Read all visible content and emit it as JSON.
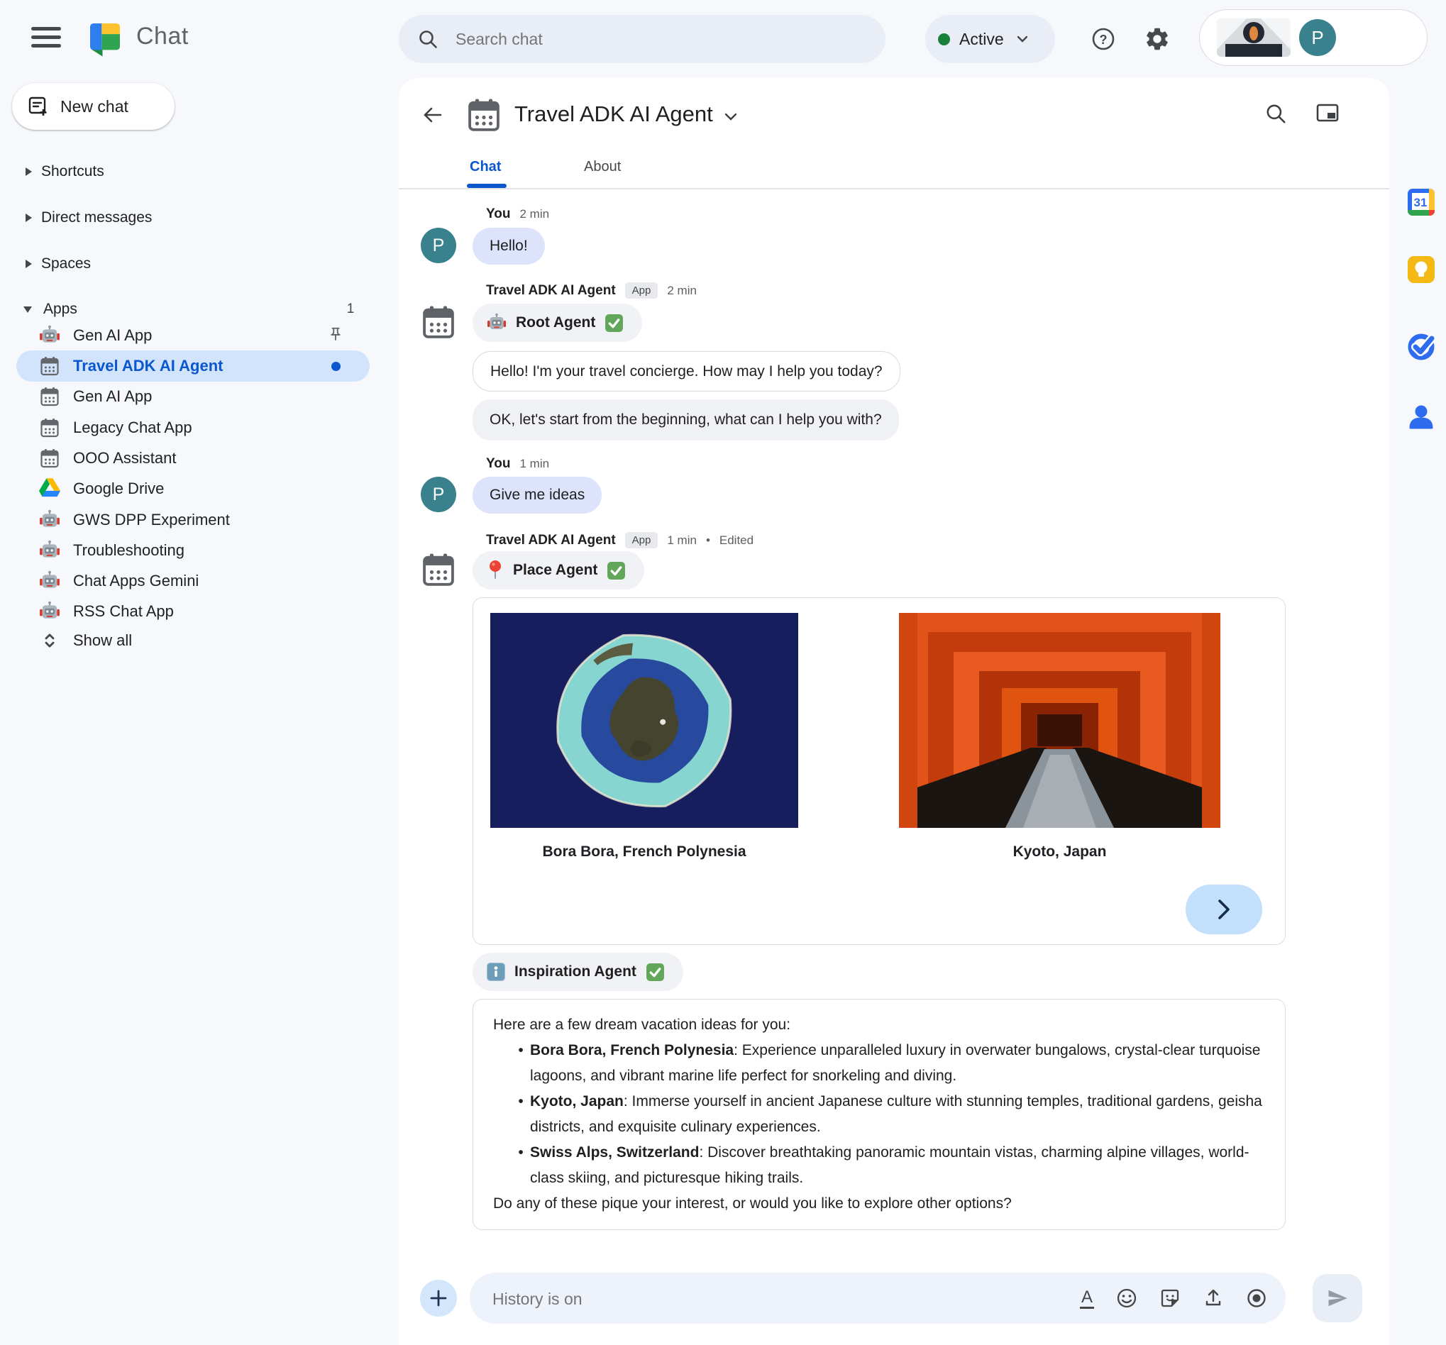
{
  "topbar": {
    "product": "Chat",
    "search_placeholder": "Search chat",
    "status": "Active",
    "profile_initial": "P"
  },
  "nav": {
    "new_chat": "New chat",
    "sections": {
      "shortcuts": "Shortcuts",
      "direct_messages": "Direct messages",
      "spaces": "Spaces",
      "apps": "Apps"
    },
    "apps_count": "1",
    "apps": [
      {
        "label": "Gen AI App",
        "icon": "robot-icon"
      },
      {
        "label": "Travel ADK AI Agent",
        "icon": "calendar-icon",
        "selected": true
      },
      {
        "label": "Gen AI App",
        "icon": "calendar-icon"
      },
      {
        "label": "Legacy Chat App",
        "icon": "calendar-icon"
      },
      {
        "label": "OOO Assistant",
        "icon": "calendar-icon"
      },
      {
        "label": "Google Drive",
        "icon": "drive-icon"
      },
      {
        "label": "GWS DPP Experiment",
        "icon": "robot-icon"
      },
      {
        "label": "Troubleshooting",
        "icon": "robot-icon"
      },
      {
        "label": "Chat Apps Gemini",
        "icon": "robot-icon"
      },
      {
        "label": "RSS Chat App",
        "icon": "robot-icon"
      }
    ],
    "show_all": "Show all"
  },
  "chat": {
    "title": "Travel ADK AI Agent",
    "tabs": {
      "chat": "Chat",
      "about": "About"
    },
    "m1": {
      "sender": "You",
      "time": "2 min",
      "text": "Hello!"
    },
    "m2": {
      "sender": "Travel ADK AI Agent",
      "badge": "App",
      "time": "2 min",
      "agent": "Root Agent",
      "bubble1": "Hello! I'm your travel concierge. How may I help you today?",
      "bubble2": "OK, let's start from the beginning, what can I help you with?"
    },
    "m3": {
      "sender": "You",
      "time": "1 min",
      "text": "Give me ideas"
    },
    "m4": {
      "sender": "Travel ADK AI Agent",
      "badge": "App",
      "time": "1 min",
      "separator": "•",
      "edited": "Edited",
      "agent": "Place Agent",
      "places": [
        {
          "caption": "Bora Bora, French Polynesia"
        },
        {
          "caption": "Kyoto, Japan"
        }
      ],
      "agent2": "Inspiration Agent",
      "intro": "Here are a few dream vacation ideas for you:",
      "bullet_char": "•",
      "bullets": [
        {
          "title": "Bora Bora, French Polynesia",
          "desc": ": Experience unparalleled luxury in overwater bungalows, crystal-clear turquoise lagoons, and vibrant marine life perfect for snorkeling and diving."
        },
        {
          "title": "Kyoto, Japan",
          "desc": ": Immerse yourself in ancient Japanese culture with stunning temples, traditional gardens, geisha districts, and exquisite culinary experiences."
        },
        {
          "title": "Swiss Alps, Switzerland",
          "desc": ": Discover breathtaking panoramic mountain vistas, charming alpine villages, world-class skiing, and picturesque hiking trails."
        }
      ],
      "outro": "Do any of these pique your interest, or would you like to explore other options?"
    }
  },
  "composer": {
    "placeholder": "History is on"
  },
  "rail": {
    "calendar_label": "31"
  },
  "colors": {
    "accent_blue": "#0b57d0",
    "active_green": "#188038",
    "selected_item_bg": "#d2e3fc",
    "user_bubble": "#dde3fb",
    "agent_chip": "#f1f2f5"
  }
}
